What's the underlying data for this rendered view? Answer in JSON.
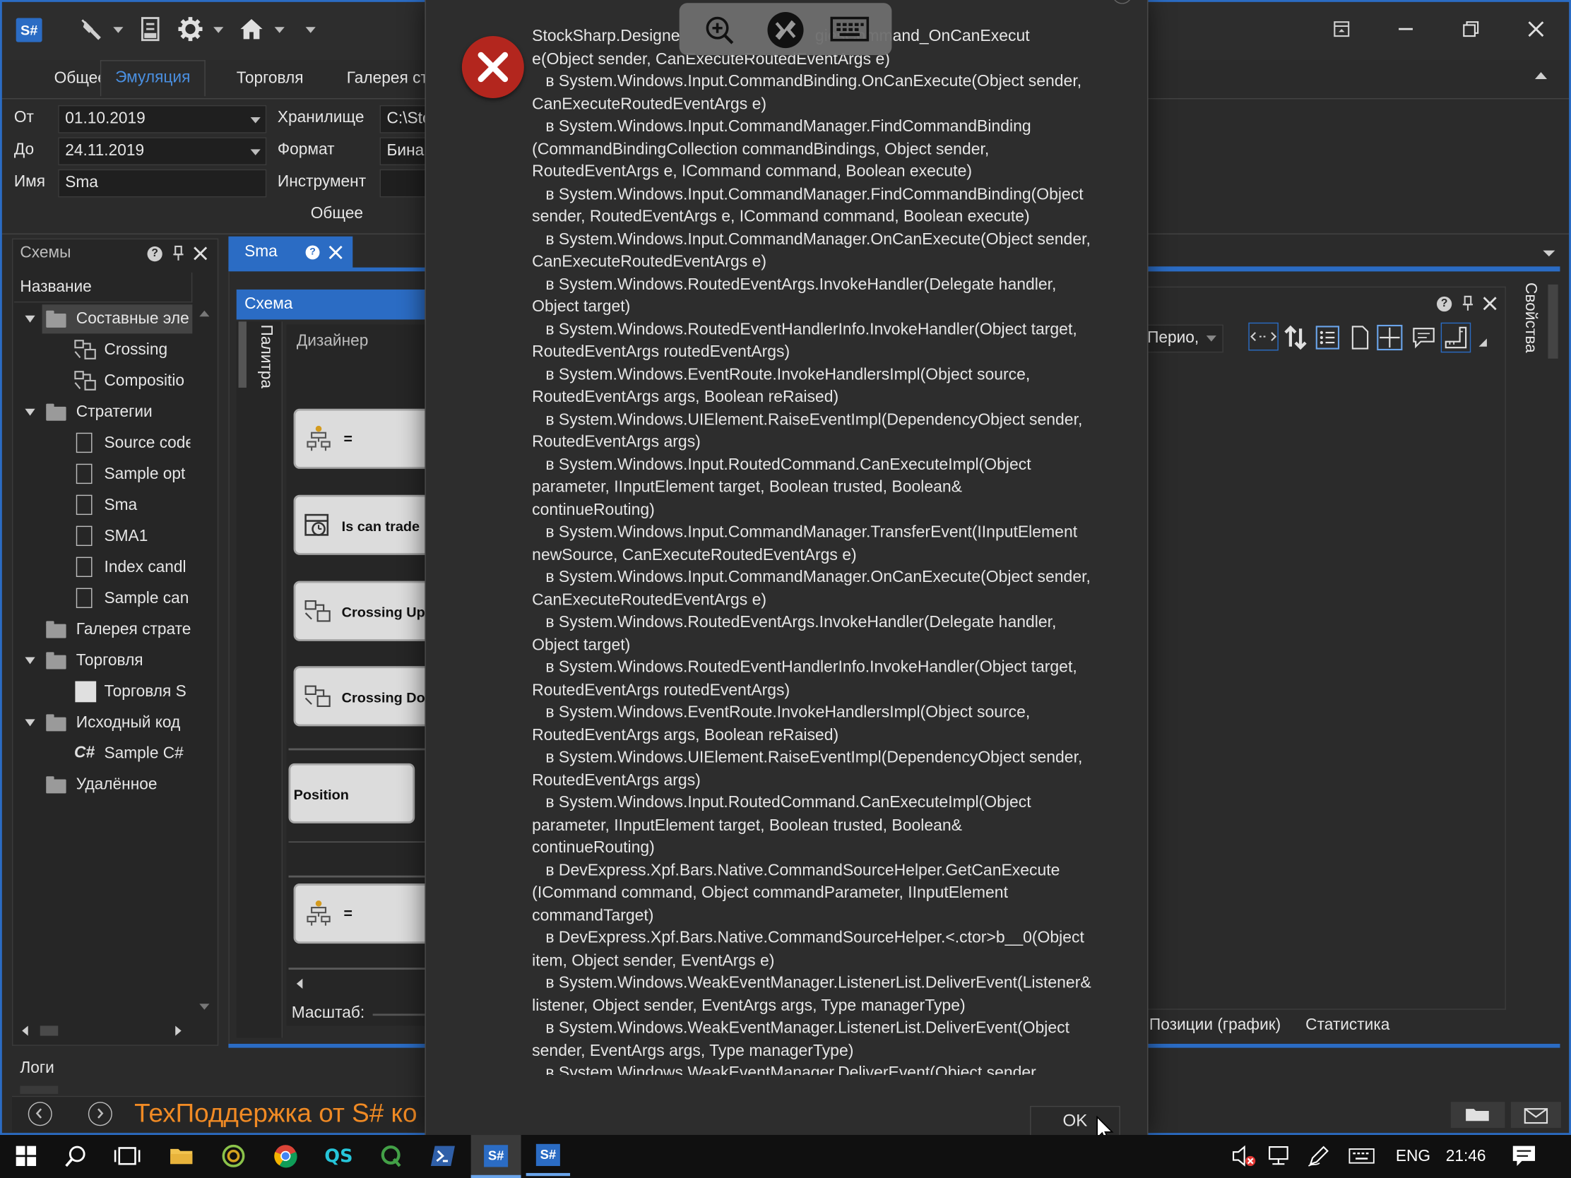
{
  "app": {
    "logo": "S#",
    "ribbon_tabs": [
      "Общее",
      "Эмуляция",
      "Торговля",
      "Галерея ст"
    ],
    "ribbon_active": "Эмуляция",
    "window_buttons": [
      "restore-icon",
      "minimize-icon",
      "maximize-icon",
      "close-icon"
    ]
  },
  "ribbon": {
    "from_label": "От",
    "from_value": "01.10.2019",
    "to_label": "До",
    "to_value": "24.11.2019",
    "name_label": "Имя",
    "name_value": "Sma",
    "storage_label": "Хранилище",
    "storage_value": "C:\\Sto",
    "format_label": "Формат",
    "format_value": "Бина",
    "instrument_label": "Инструмент",
    "instrument_value": "",
    "group_label": "Общее"
  },
  "schemes_panel": {
    "title": "Схемы",
    "column": "Название",
    "items": [
      {
        "label": "Составные эле",
        "kind": "folder",
        "expanded": true,
        "level": 0,
        "selected": true
      },
      {
        "label": "Crossing",
        "kind": "composite",
        "level": 1
      },
      {
        "label": "Compositio",
        "kind": "composite",
        "level": 1
      },
      {
        "label": "Стратегии",
        "kind": "folder",
        "expanded": true,
        "level": 0
      },
      {
        "label": "Source code",
        "kind": "doc",
        "level": 1
      },
      {
        "label": "Sample opt",
        "kind": "doc",
        "level": 1
      },
      {
        "label": "Sma",
        "kind": "doc",
        "level": 1
      },
      {
        "label": "SMA1",
        "kind": "doc",
        "level": 1
      },
      {
        "label": "Index candl",
        "kind": "doc",
        "level": 1
      },
      {
        "label": "Sample can",
        "kind": "doc",
        "level": 1
      },
      {
        "label": "Галерея страте",
        "kind": "folder",
        "expanded": false,
        "level": 0
      },
      {
        "label": "Торговля",
        "kind": "folder",
        "expanded": true,
        "level": 0
      },
      {
        "label": "Торговля S",
        "kind": "square",
        "level": 1
      },
      {
        "label": "Исходный код",
        "kind": "folder",
        "expanded": true,
        "level": 0
      },
      {
        "label": "Sample C#",
        "kind": "csharp",
        "level": 1
      },
      {
        "label": "Удалённое",
        "kind": "folder",
        "expanded": false,
        "level": 0
      }
    ]
  },
  "doc_tab": {
    "title": "Sma",
    "schema_header": "Схема",
    "palette_label": "Палитра",
    "designer_label": "Дизайнер",
    "scale_label": "Масштаб:",
    "nodes": [
      {
        "label": "="
      },
      {
        "label": "Is can trade"
      },
      {
        "label": "Crossing Up"
      },
      {
        "label": "Crossing Do"
      },
      {
        "label": "Position"
      },
      {
        "label": "="
      }
    ]
  },
  "right_panel": {
    "period_value": "Перио,",
    "properties_label": "Свойства",
    "bottom_tabs": [
      "Позиции (график)",
      "Статистика"
    ]
  },
  "logs": {
    "label": "Логи",
    "banner": "ТехПоддержка от S# ко"
  },
  "dialog": {
    "ok_label": "OK",
    "stack_lines": [
      "StockSharp.Designe                              giesCommand_OnCanExecut\ne(Object sender, CanExecuteRoutedEventArgs e)",
      "   в System.Windows.Input.CommandBinding.OnCanExecute(Object sender,\nCanExecuteRoutedEventArgs e)",
      "   в System.Windows.Input.CommandManager.FindCommandBinding\n(CommandBindingCollection commandBindings, Object sender,\nRoutedEventArgs e, ICommand command, Boolean execute)",
      "   в System.Windows.Input.CommandManager.FindCommandBinding(Object\nsender, RoutedEventArgs e, ICommand command, Boolean execute)",
      "   в System.Windows.Input.CommandManager.OnCanExecute(Object sender,\nCanExecuteRoutedEventArgs e)",
      "   в System.Windows.RoutedEventArgs.InvokeHandler(Delegate handler,\nObject target)",
      "   в System.Windows.RoutedEventHandlerInfo.InvokeHandler(Object target,\nRoutedEventArgs routedEventArgs)",
      "   в System.Windows.EventRoute.InvokeHandlersImpl(Object source,\nRoutedEventArgs args, Boolean reRaised)",
      "   в System.Windows.UIElement.RaiseEventImpl(DependencyObject sender,\nRoutedEventArgs args)",
      "   в System.Windows.Input.RoutedCommand.CanExecuteImpl(Object\nparameter, IInputElement target, Boolean trusted, Boolean&\ncontinueRouting)",
      "   в System.Windows.Input.CommandManager.TransferEvent(IInputElement\nnewSource, CanExecuteRoutedEventArgs e)",
      "   в System.Windows.Input.CommandManager.OnCanExecute(Object sender,\nCanExecuteRoutedEventArgs e)",
      "   в System.Windows.RoutedEventArgs.InvokeHandler(Delegate handler,\nObject target)",
      "   в System.Windows.RoutedEventHandlerInfo.InvokeHandler(Object target,\nRoutedEventArgs routedEventArgs)",
      "   в System.Windows.EventRoute.InvokeHandlersImpl(Object source,\nRoutedEventArgs args, Boolean reRaised)",
      "   в System.Windows.UIElement.RaiseEventImpl(DependencyObject sender,\nRoutedEventArgs args)",
      "   в System.Windows.Input.RoutedCommand.CanExecuteImpl(Object\nparameter, IInputElement target, Boolean trusted, Boolean&\ncontinueRouting)",
      "   в DevExpress.Xpf.Bars.Native.CommandSourceHelper.GetCanExecute\n(ICommand command, Object commandParameter, IInputElement\ncommandTarget)",
      "   в DevExpress.Xpf.Bars.Native.CommandSourceHelper.<.ctor>b__0(Object\nitem, Object sender, EventArgs e)",
      "   в System.Windows.WeakEventManager.ListenerList.DeliverEvent(Listener&\nlistener, Object sender, EventArgs args, Type managerType)",
      "   в System.Windows.WeakEventManager.ListenerList.DeliverEvent(Object\nsender, EventArgs args, Type managerType)",
      "   в System.Windows.WeakEventManager.DeliverEvent(Object sender"
    ]
  },
  "taskbar": {
    "lang": "ENG",
    "time": "21:46"
  },
  "colors": {
    "accent": "#2b6cc4",
    "error_red": "#b3261e",
    "banner_orange": "#f08a24",
    "panel_bg": "#2b2b2b"
  }
}
